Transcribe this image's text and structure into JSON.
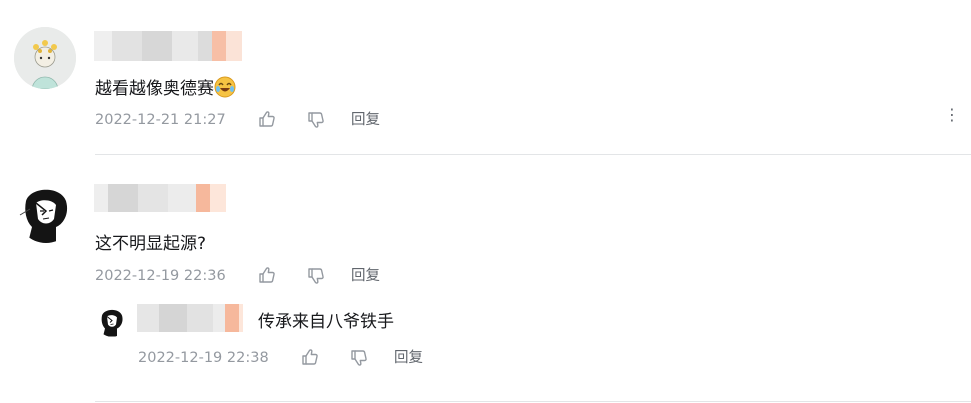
{
  "comments": [
    {
      "text": "越看越像奥德赛",
      "emoji": "laughing-crying-emoji",
      "time": "2022-12-21 21:27",
      "reply_label": "回复",
      "more_icon": "⋮"
    },
    {
      "text": "这不明显起源?",
      "time": "2022-12-19 22:36",
      "reply_label": "回复",
      "sub_replies": [
        {
          "text": "传承来自八爷铁手",
          "time": "2022-12-19 22:38",
          "reply_label": "回复"
        }
      ]
    }
  ],
  "colors": {
    "meta": "#9499a0",
    "text": "#18191c",
    "divider": "#e3e5e7",
    "mosaic_gray": "#d9d9d9",
    "mosaic_peach": "#f7bfa6"
  }
}
